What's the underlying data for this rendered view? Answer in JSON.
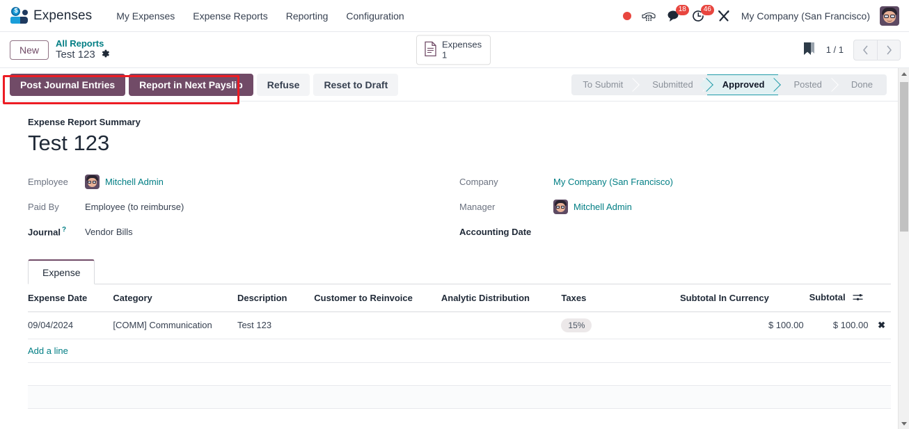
{
  "navbar": {
    "brand": "Expenses",
    "menu": [
      {
        "label": "My Expenses"
      },
      {
        "label": "Expense Reports"
      },
      {
        "label": "Reporting"
      },
      {
        "label": "Configuration"
      }
    ],
    "messages_badge": "18",
    "activities_badge": "46",
    "company": "My Company (San Francisco)",
    "icons": {
      "record_dot": "record-dot-icon",
      "phone": "phone-dialpad-icon",
      "messages": "chat-bubble-icon",
      "activities": "clock-activity-icon",
      "debug": "wrench-tools-icon",
      "avatar": "user-avatar"
    },
    "accent_red": "#e8463f",
    "accent_blue": "#1a9ed9"
  },
  "control_panel": {
    "new_label": "New",
    "breadcrumb_parent": "All Reports",
    "breadcrumb_current": "Test 123",
    "gear_icon": "gear-icon",
    "stat_button": {
      "label": "Expenses",
      "value": "1",
      "icon": "document-icon"
    },
    "bookmark_icon": "bookmark-ribbon-icon",
    "pager": "1 / 1",
    "pager_prev_icon": "chevron-left-icon",
    "pager_next_icon": "chevron-right-icon"
  },
  "actions": {
    "primary": [
      {
        "label": "Post Journal Entries"
      },
      {
        "label": "Report in Next Payslip"
      }
    ],
    "secondary": [
      {
        "label": "Refuse"
      },
      {
        "label": "Reset to Draft"
      }
    ],
    "highlight_color": "#ec1c24",
    "primary_color": "#714b67"
  },
  "statusbar": {
    "steps": [
      {
        "label": "To Submit",
        "active": false
      },
      {
        "label": "Submitted",
        "active": false
      },
      {
        "label": "Approved",
        "active": true
      },
      {
        "label": "Posted",
        "active": false
      },
      {
        "label": "Done",
        "active": false
      }
    ],
    "active_color": "#1f9aa8"
  },
  "form": {
    "summary_label": "Expense Report Summary",
    "title": "Test 123",
    "left": [
      {
        "label": "Employee",
        "value": "Mitchell Admin",
        "link": true,
        "avatar": true,
        "bold_label": false
      },
      {
        "label": "Paid By",
        "value": "Employee (to reimburse)",
        "link": false,
        "avatar": false,
        "bold_label": false
      },
      {
        "label": "Journal",
        "value": "Vendor Bills",
        "link": false,
        "avatar": false,
        "bold_label": true,
        "tooltip": "?"
      }
    ],
    "right": [
      {
        "label": "Company",
        "value": "My Company (San Francisco)",
        "link": true,
        "avatar": false,
        "bold_label": false
      },
      {
        "label": "Manager",
        "value": "Mitchell Admin",
        "link": true,
        "avatar": true,
        "bold_label": false
      },
      {
        "label": "Accounting Date",
        "value": "",
        "link": false,
        "avatar": false,
        "bold_label": true
      }
    ]
  },
  "notebook": {
    "tabs": [
      {
        "label": "Expense",
        "active": true
      }
    ],
    "columns": [
      "Expense Date",
      "Category",
      "Description",
      "Customer to Reinvoice",
      "Analytic Distribution",
      "Taxes",
      "Subtotal In Currency",
      "Subtotal"
    ],
    "settings_icon": "column-settings-icon",
    "rows": [
      {
        "date": "09/04/2024",
        "category": "[COMM] Communication",
        "description": "Test 123",
        "customer": "",
        "analytic": "",
        "taxes": "15%",
        "subtotal_currency": "$ 100.00",
        "subtotal": "$ 100.00",
        "delete_icon": "delete-row-icon"
      }
    ],
    "add_line_label": "Add a line"
  },
  "scrollbar": {
    "up_icon": "scroll-up-arrow",
    "down_icon": "scroll-down-arrow"
  }
}
